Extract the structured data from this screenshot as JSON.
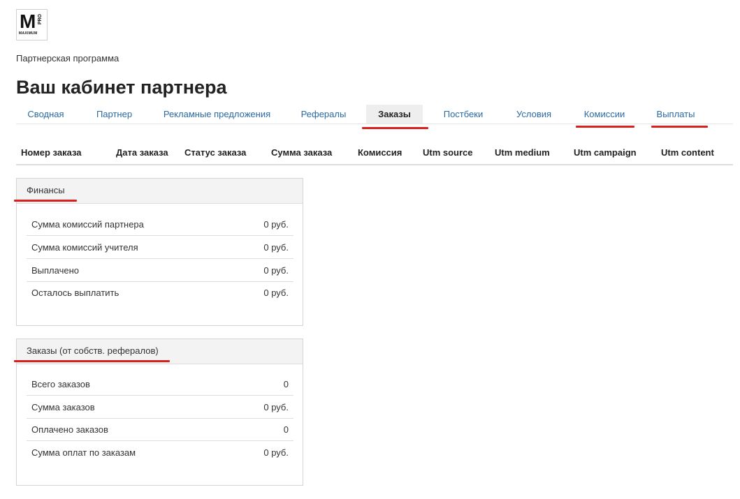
{
  "logo": {
    "letter": "M",
    "pro": "PRO",
    "wordmark": "MAXIMUM"
  },
  "breadcrumb": "Партнерская программа",
  "page_title": "Ваш кабинет партнера",
  "tabs": [
    {
      "label": "Сводная"
    },
    {
      "label": "Партнер"
    },
    {
      "label": "Рекламные предложения"
    },
    {
      "label": "Рефералы"
    },
    {
      "label": "Заказы",
      "active": true
    },
    {
      "label": "Постбеки"
    },
    {
      "label": "Условия"
    },
    {
      "label": "Комиссии"
    },
    {
      "label": "Выплаты"
    }
  ],
  "orders_table": {
    "columns": [
      "Номер заказа",
      "Дата заказа",
      "Статус заказа",
      "Сумма заказа",
      "Комиссия",
      "Utm source",
      "Utm medium",
      "Utm campaign",
      "Utm content"
    ]
  },
  "finances": {
    "title": "Финансы",
    "rows": [
      {
        "label": "Сумма комиссий партнера",
        "value": "0 руб."
      },
      {
        "label": "Сумма комиссий учителя",
        "value": "0 руб."
      },
      {
        "label": "Выплачено",
        "value": "0 руб."
      },
      {
        "label": "Осталось выплатить",
        "value": "0 руб."
      }
    ]
  },
  "orders_summary": {
    "title": "Заказы (от собств. рефералов)",
    "rows": [
      {
        "label": "Всего заказов",
        "value": "0"
      },
      {
        "label": "Сумма заказов",
        "value": "0 руб."
      },
      {
        "label": "Оплачено заказов",
        "value": "0"
      },
      {
        "label": "Сумма оплат по заказам",
        "value": "0 руб."
      }
    ]
  },
  "colors": {
    "link": "#2a6aa5",
    "highlight": "#d9201d",
    "panel_header": "#f3f3f3"
  }
}
